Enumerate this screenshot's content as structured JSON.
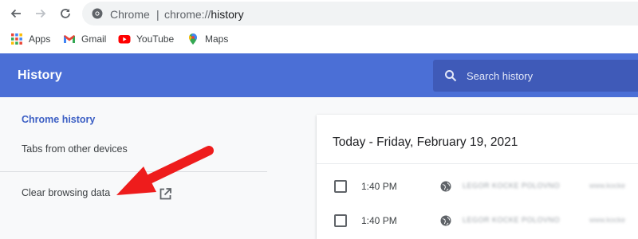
{
  "browser": {
    "omnibox": {
      "site": "Chrome",
      "separator": "|",
      "url_scheme": "chrome://",
      "url_path": "history"
    }
  },
  "bookmarks": [
    {
      "label": "Apps",
      "icon": "apps-grid-icon"
    },
    {
      "label": "Gmail",
      "icon": "gmail-icon"
    },
    {
      "label": "YouTube",
      "icon": "youtube-icon"
    },
    {
      "label": "Maps",
      "icon": "maps-icon"
    }
  ],
  "header": {
    "title": "History",
    "search_placeholder": "Search history"
  },
  "sidebar": {
    "items": [
      {
        "label": "Chrome history",
        "active": true
      },
      {
        "label": "Tabs from other devices"
      },
      {
        "label": "Clear browsing data"
      }
    ]
  },
  "main": {
    "date_heading": "Today - Friday, February 19, 2021",
    "entries": [
      {
        "time": "1:40 PM",
        "title": "LEGOR KOCKE POLOVNO",
        "domain": "www.kocke"
      },
      {
        "time": "1:40 PM",
        "title": "LEGOR KOCKE POLOVNO",
        "domain": "www.kocke"
      }
    ]
  },
  "colors": {
    "header_blue": "#4b6fd6",
    "search_box_blue": "#3f5ab8",
    "active_link": "#3c5fc4",
    "annotation_arrow": "#ee1c1c"
  }
}
